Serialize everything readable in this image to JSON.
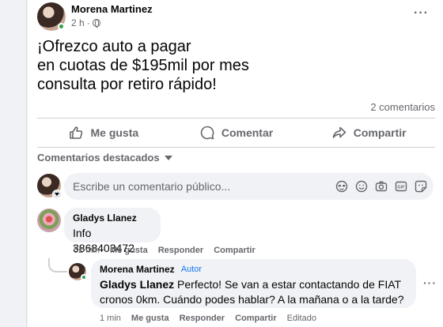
{
  "post": {
    "author": "Morena Martinez",
    "time": "2 h",
    "text": "¡Ofrezco auto a pagar\nen cuotas de $195mil por mes\nconsulta por retiro rápido!",
    "comment_count": "2 comentarios"
  },
  "actions": {
    "like": "Me gusta",
    "comment": "Comentar",
    "share": "Compartir"
  },
  "comments_section": {
    "filter_label": "Comentarios destacados",
    "composer_placeholder": "Escribe un comentario público...",
    "composer_icons": [
      "sticker-avatar-icon",
      "emoji-icon",
      "camera-icon",
      "gif-icon",
      "sticker-icon"
    ]
  },
  "comments": [
    {
      "author": "Gladys Llanez",
      "text": "Info 3868403472",
      "time": "52 min",
      "like": "Me gusta",
      "reply": "Responder",
      "share": "Compartir"
    }
  ],
  "reply": {
    "author": "Morena Martinez",
    "badge": "Autor",
    "mention": "Gladys Llanez",
    "text": " Perfecto! Se van a estar contactando de FIAT cronos 0km. Cuándo podes hablar? A la mañana o a la tarde?",
    "time": "1 min",
    "like": "Me gusta",
    "reply": "Responder",
    "share": "Compartir",
    "edited": "Editado"
  },
  "colors": {
    "accent": "#1877f2",
    "secondary_text": "#65676b",
    "bubble_bg": "#f0f2f5",
    "online": "#31a24c"
  }
}
